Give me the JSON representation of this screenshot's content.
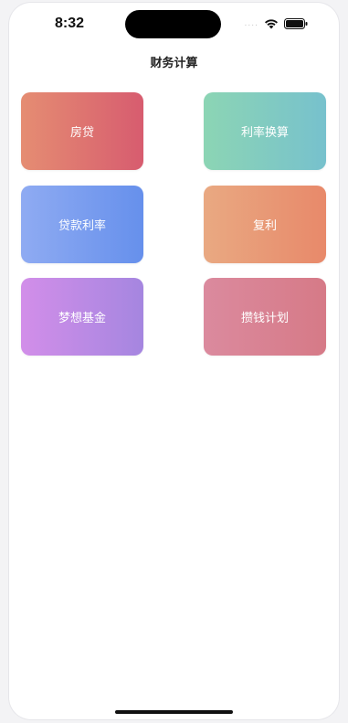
{
  "status_bar": {
    "time": "8:32",
    "signal": "....",
    "wifi_icon": "wifi-icon",
    "battery_icon": "battery-icon"
  },
  "nav": {
    "title": "财务计算"
  },
  "cards": [
    {
      "label": "房贷",
      "colors": [
        "#E58D72",
        "#D75C6F"
      ]
    },
    {
      "label": "利率换算",
      "colors": [
        "#8CD5B4",
        "#77C1CD"
      ]
    },
    {
      "label": "贷款利率",
      "colors": [
        "#8FABF2",
        "#6690EC"
      ]
    },
    {
      "label": "复利",
      "colors": [
        "#E9A982",
        "#E8896A"
      ]
    },
    {
      "label": "梦想基金",
      "colors": [
        "#D28EE9",
        "#A586E0"
      ]
    },
    {
      "label": "攒钱计划",
      "colors": [
        "#DB8A9E",
        "#D67A87"
      ]
    }
  ]
}
